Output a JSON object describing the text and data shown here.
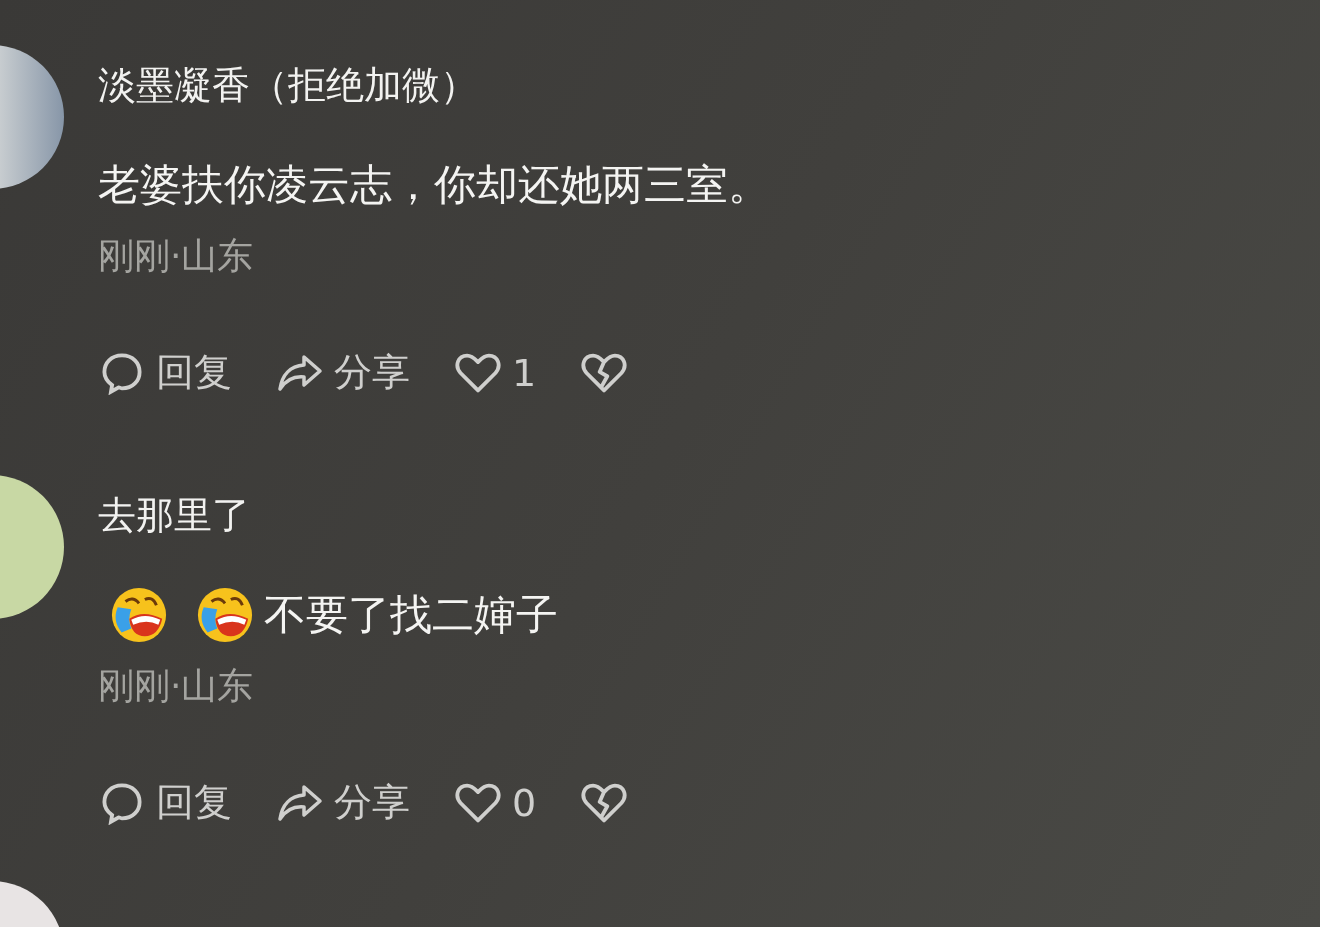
{
  "comments": [
    {
      "author": "淡墨凝香（拒绝加微）",
      "content": [
        {
          "kind": "text",
          "text": "老婆扶你凌云志，你却还她两三室。"
        }
      ],
      "meta": "刚刚·山东",
      "actions": {
        "reply": "回复",
        "share": "分享",
        "likes": "1"
      }
    },
    {
      "author": "去那里了",
      "content": [
        {
          "kind": "emoji"
        },
        {
          "kind": "emoji"
        },
        {
          "kind": "text",
          "text": "不要了找二婶子"
        }
      ],
      "meta": "刚刚·山东",
      "actions": {
        "reply": "回复",
        "share": "分享",
        "likes": "0"
      }
    }
  ],
  "more_comment": {
    "avatar": true
  }
}
